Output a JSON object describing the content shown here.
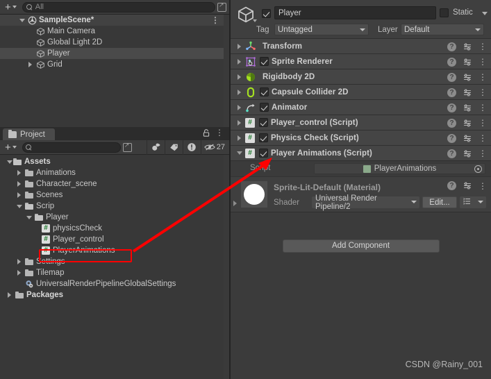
{
  "hierarchy": {
    "toolbar": {
      "add_label": "+",
      "search_placeholder": "All",
      "search_value": ""
    },
    "items": [
      {
        "label": "SampleScene*",
        "icon": "unity-scene-icon",
        "expanded": true,
        "depth": 0,
        "selected": false,
        "root": true
      },
      {
        "label": "Main Camera",
        "icon": "game-object-icon",
        "expanded": null,
        "depth": 1,
        "selected": false,
        "root": false
      },
      {
        "label": "Global Light 2D",
        "icon": "game-object-icon",
        "expanded": null,
        "depth": 1,
        "selected": false,
        "root": false
      },
      {
        "label": "Player",
        "icon": "game-object-icon",
        "expanded": null,
        "depth": 1,
        "selected": true,
        "root": false
      },
      {
        "label": "Grid",
        "icon": "game-object-icon",
        "expanded": false,
        "depth": 1,
        "selected": false,
        "root": false
      }
    ]
  },
  "project": {
    "tab_label": "Project",
    "toolbar": {
      "add_label": "+",
      "search_value": "",
      "hidden_count": "27"
    },
    "items": [
      {
        "label": "Assets",
        "type": "folder-open",
        "depth": 0,
        "expanded": true,
        "bold": true
      },
      {
        "label": "Animations",
        "type": "folder",
        "depth": 1,
        "expanded": false,
        "bold": false
      },
      {
        "label": "Character_scene",
        "type": "folder",
        "depth": 1,
        "expanded": false,
        "bold": false
      },
      {
        "label": "Scenes",
        "type": "folder",
        "depth": 1,
        "expanded": false,
        "bold": false
      },
      {
        "label": "Scrip",
        "type": "folder-open",
        "depth": 1,
        "expanded": true,
        "bold": false
      },
      {
        "label": "Player",
        "type": "folder-open",
        "depth": 2,
        "expanded": true,
        "bold": false
      },
      {
        "label": "physicsCheck",
        "type": "cs-script",
        "depth": 3,
        "expanded": null,
        "bold": false
      },
      {
        "label": "Player_control",
        "type": "cs-script",
        "depth": 3,
        "expanded": null,
        "bold": false
      },
      {
        "label": "PlayerAnimations",
        "type": "cs-script",
        "depth": 3,
        "expanded": null,
        "bold": false
      },
      {
        "label": "Settings",
        "type": "folder",
        "depth": 1,
        "expanded": false,
        "bold": false
      },
      {
        "label": "Tilemap",
        "type": "folder",
        "depth": 1,
        "expanded": false,
        "bold": false
      },
      {
        "label": "UniversalRenderPipelineGlobalSettings",
        "type": "asset",
        "depth": 1,
        "expanded": null,
        "bold": false
      },
      {
        "label": "Packages",
        "type": "folder",
        "depth": 0,
        "expanded": false,
        "bold": true
      }
    ]
  },
  "inspector": {
    "object_name": "Player",
    "enabled": true,
    "static_label": "Static",
    "static_checked": false,
    "tag_label": "Tag",
    "tag_value": "Untagged",
    "layer_label": "Layer",
    "layer_value": "Default",
    "components": [
      {
        "name": "Transform",
        "icon": "transform-icon",
        "expanded": false,
        "has_checkbox": false,
        "checked": false
      },
      {
        "name": "Sprite Renderer",
        "icon": "sprite-renderer-icon",
        "expanded": false,
        "has_checkbox": true,
        "checked": true
      },
      {
        "name": "Rigidbody 2D",
        "icon": "rigidbody2d-icon",
        "expanded": false,
        "has_checkbox": false,
        "checked": false
      },
      {
        "name": "Capsule Collider 2D",
        "icon": "capsule-collider2d-icon",
        "expanded": false,
        "has_checkbox": true,
        "checked": true
      },
      {
        "name": "Animator",
        "icon": "animator-icon",
        "expanded": false,
        "has_checkbox": true,
        "checked": true
      },
      {
        "name": "Player_control (Script)",
        "icon": "cs-script-icon",
        "expanded": false,
        "has_checkbox": true,
        "checked": true
      },
      {
        "name": "Physics Check (Script)",
        "icon": "cs-script-icon",
        "expanded": false,
        "has_checkbox": true,
        "checked": true
      },
      {
        "name": "Player Animations (Script)",
        "icon": "cs-script-icon",
        "expanded": true,
        "has_checkbox": true,
        "checked": true
      }
    ],
    "script_field": {
      "label": "Script",
      "value": "PlayerAnimations"
    },
    "material": {
      "title": "Sprite-Lit-Default (Material)",
      "shader_label": "Shader",
      "shader_value": "Universal Render Pipeline/2",
      "edit_label": "Edit..."
    },
    "add_component_label": "Add Component"
  },
  "watermark": "CSDN @Rainy_001",
  "colors": {
    "panel_bg": "#383838",
    "inspector_bg": "#3b3b3b",
    "component_row": "#454545",
    "selection": "#4a4a4a",
    "annotation_red": "#ff0000",
    "script_green": "#1f7a2e",
    "collider_green": "#a4e021"
  }
}
